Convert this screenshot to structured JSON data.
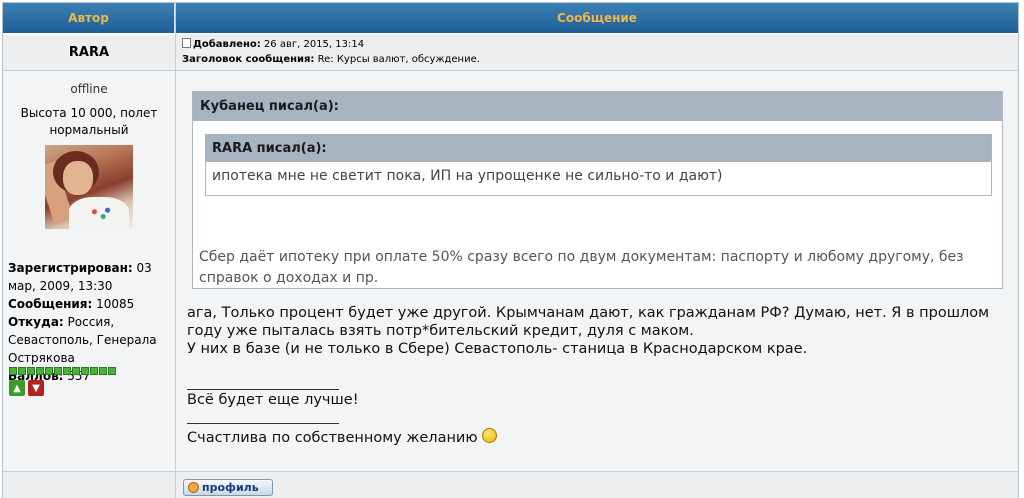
{
  "table_header": {
    "author": "Автор",
    "message": "Сообщение"
  },
  "post": {
    "author_name": "RARA",
    "added_label": "Добавлено:",
    "added_date": "26 авг, 2015, 13:14",
    "subject_label": "Заголовок сообщения:",
    "subject_value": "Re: Курсы валют, обсуждение."
  },
  "profile": {
    "status": "offline",
    "rank": "Высота 10 000, полет нормальный",
    "registered_label": "Зарегистрирован:",
    "registered_value": "03 мар, 2009, 13:30",
    "messages_label": "Сообщения:",
    "messages_value": "10085",
    "from_label": "Откуда:",
    "from_value": "Россия, Севастополь, Генерала Острякова",
    "points_label": "Баллов:",
    "points_value": "557",
    "rating_stars": 12
  },
  "quote_outer": {
    "header": "Кубанец писал(а):",
    "body": "Сбер даёт ипотеку при оплате 50% сразу всего по двум документам: паспорту и любому другому, без справок о доходах и пр."
  },
  "quote_inner": {
    "header": "RARA писал(а):",
    "body": "ипотека мне не светит пока, ИП на упрощенке не сильно-то и дают)"
  },
  "message": {
    "line1": "ага, Только процент будет уже другой. Крымчанам дают, как гражданам РФ? Думаю, нет. Я в прошлом году уже пыталась взять потр*бительский кредит, дуля с маком.",
    "line2": "У них в базе (и не только в Сбере) Севастополь- станица в Краснодарском крае."
  },
  "signature": {
    "line1": "Всё будет еще лучше!",
    "line2": "Счастлива по собственному желанию"
  },
  "footer": {
    "profile_button": "профиль"
  },
  "colors": {
    "header_bg": "#1c5e96",
    "header_text": "#f0b64a",
    "quote_header_bg": "#a7b3bf"
  }
}
